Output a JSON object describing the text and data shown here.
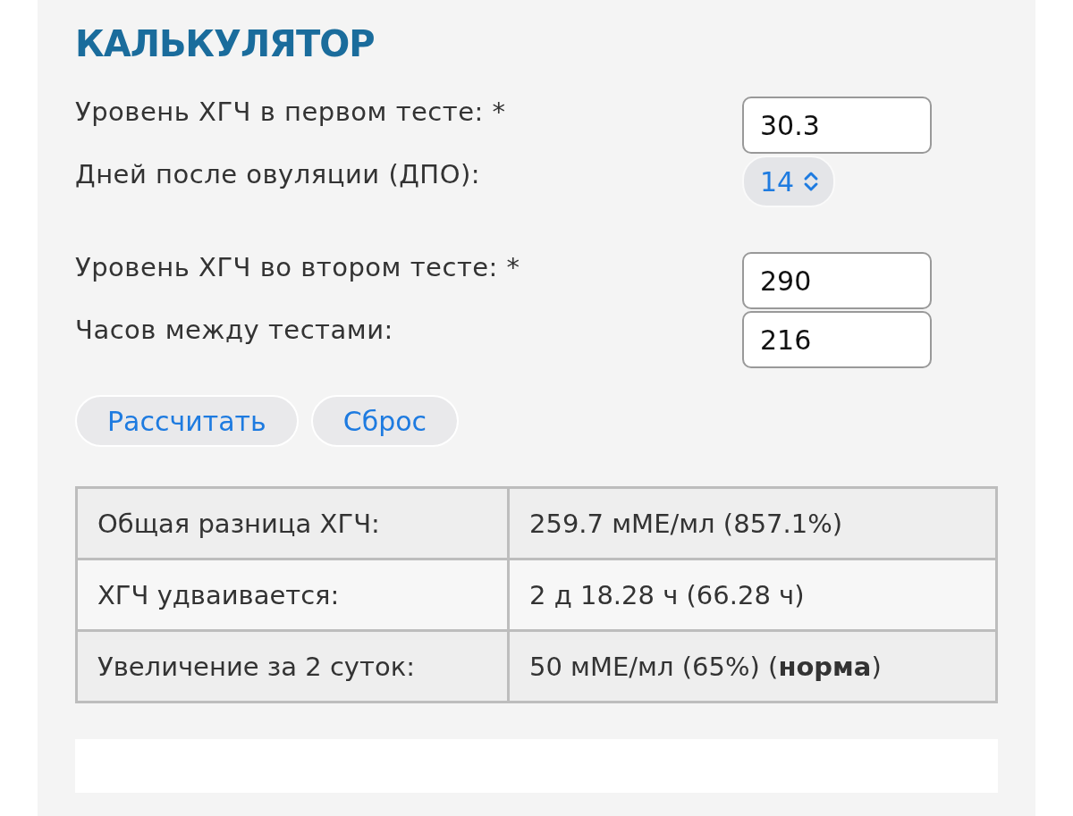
{
  "title": "КАЛЬКУЛЯТОР",
  "groups": [
    {
      "fields": [
        {
          "kind": "input",
          "label": "Уровень ХГЧ в первом тесте: *",
          "value": "30.3"
        },
        {
          "kind": "select",
          "label": "Дней после овуляции (ДПО):",
          "value": "14"
        }
      ]
    },
    {
      "fields": [
        {
          "kind": "input",
          "label": "Уровень ХГЧ во втором тесте: *",
          "value": "290"
        },
        {
          "kind": "input",
          "label": "Часов между тестами:",
          "value": "216"
        }
      ]
    }
  ],
  "buttons": [
    "Рассчитать",
    "Сброс"
  ],
  "results": [
    {
      "label": "Общая разница ХГЧ:",
      "value": "259.7 мМЕ/мл (857.1%)"
    },
    {
      "label": "ХГЧ удваивается:",
      "value": "2 д 18.28 ч (66.28 ч)"
    },
    {
      "label": "Увеличение за 2 суток:",
      "value": "50 мМЕ/мл (65%) (**норма**)"
    }
  ]
}
